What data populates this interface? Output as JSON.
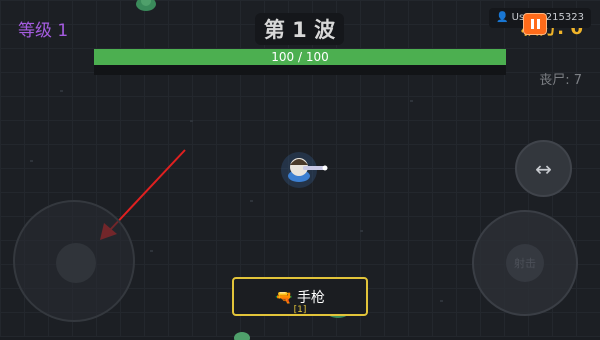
{
  "hud": {
    "level_label": "等级 1",
    "wave_label": "第 1 波",
    "hp_text": "100 / 100",
    "hp_fraction": 1.0,
    "zombie_count_label": "丧尸: 7",
    "score_label": "积分: 0",
    "user_label": "User_0215323"
  },
  "controls": {
    "swap_icon": "↔",
    "fire_label": "射击"
  },
  "weapon": {
    "icon": "🔫",
    "name": "手枪",
    "slot": "[1]"
  },
  "colors": {
    "level": "#a55ce0",
    "hp_bar": "#4caf50",
    "score": "#f0b429",
    "pause": "#ff6b1a",
    "weapon_border": "#e2c43a",
    "arrow": "#e02020"
  }
}
